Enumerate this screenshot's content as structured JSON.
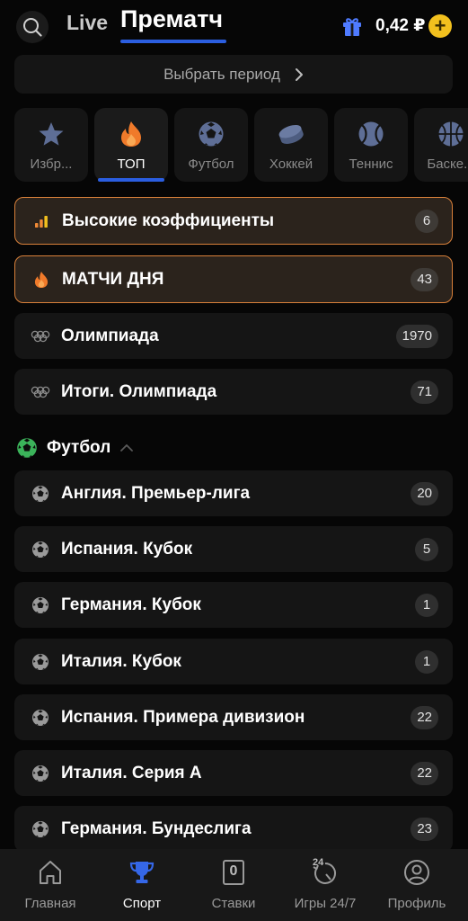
{
  "header": {
    "tab_live": "Live",
    "tab_prematch": "Прематч",
    "active_tab": "Прематч",
    "balance": "0,42 ₽",
    "add_funds_symbol": "+",
    "search_icon": "search-icon",
    "gift_icon": "gift-icon",
    "accent_color": "#2b5ee0"
  },
  "period": {
    "label": "Выбрать период",
    "icon": "chevron-right-icon"
  },
  "sports": [
    {
      "label": "Избр...",
      "icon": "star-icon",
      "active": false
    },
    {
      "label": "ТОП",
      "icon": "fire-icon",
      "active": true
    },
    {
      "label": "Футбол",
      "icon": "soccer-ball-icon",
      "active": false
    },
    {
      "label": "Хоккей",
      "icon": "hockey-puck-icon",
      "active": false
    },
    {
      "label": "Теннис",
      "icon": "tennis-ball-icon",
      "active": false
    },
    {
      "label": "Баске...",
      "icon": "basketball-icon",
      "active": false
    }
  ],
  "featured": [
    {
      "label": "Высокие коэффициенты",
      "count": "6",
      "icon": "bar-chart-icon"
    },
    {
      "label": "МАТЧИ ДНЯ",
      "count": "43",
      "icon": "fire-icon"
    }
  ],
  "olympics": [
    {
      "label": "Олимпиада",
      "count": "1970",
      "icon": "olympic-rings-icon"
    },
    {
      "label": "Итоги. Олимпиада",
      "count": "71",
      "icon": "olympic-rings-icon"
    }
  ],
  "football_section": {
    "title": "Футбол",
    "icon": "soccer-ball-icon",
    "toggle_icon": "chevron-up-icon"
  },
  "leagues": [
    {
      "label": "Англия. Премьер-лига",
      "count": "20"
    },
    {
      "label": "Испания. Кубок",
      "count": "5"
    },
    {
      "label": "Германия. Кубок",
      "count": "1"
    },
    {
      "label": "Италия. Кубок",
      "count": "1"
    },
    {
      "label": "Испания. Примера дивизион",
      "count": "22"
    },
    {
      "label": "Италия. Серия А",
      "count": "22"
    },
    {
      "label": "Германия. Бундеслига",
      "count": "23"
    }
  ],
  "nav": [
    {
      "label": "Главная",
      "icon": "home-icon",
      "active": false
    },
    {
      "label": "Спорт",
      "icon": "trophy-icon",
      "active": true
    },
    {
      "label": "Ставки",
      "icon": "bet-slip-icon",
      "badge": "0",
      "active": false
    },
    {
      "label": "Игры 24/7",
      "icon": "games-24-7-icon",
      "badge": "24",
      "active": false
    },
    {
      "label": "Профиль",
      "icon": "profile-icon",
      "active": false
    }
  ]
}
